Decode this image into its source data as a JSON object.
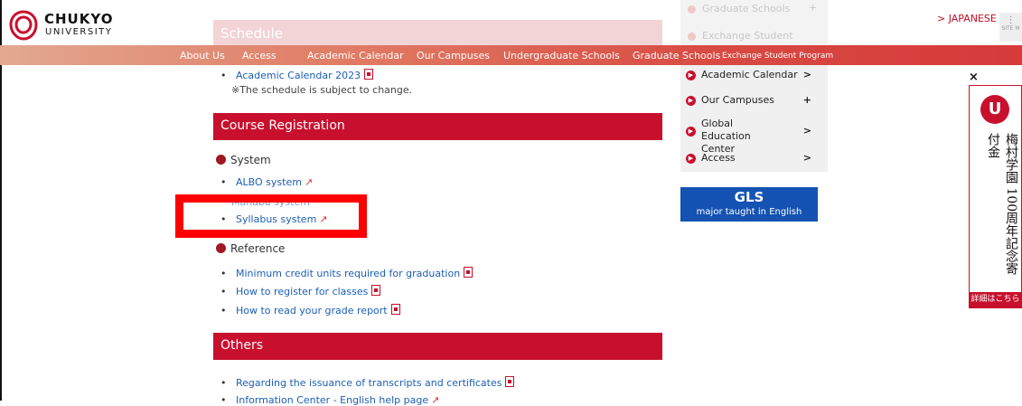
{
  "brand": {
    "name": "CHUKYO",
    "sub": "UNIVERSITY"
  },
  "header": {
    "ghost_section": "Schedule",
    "ghost_menu": [
      "Graduate Schools",
      "Exchange Student"
    ],
    "language": "> JAPANESE",
    "sitemap": "SITE M"
  },
  "nav": {
    "items": [
      "About Us",
      "Access",
      "Academic Calendar",
      "Our Campuses",
      "Undergraduate Schools",
      "Graduate Schools",
      "Exchange Student Program"
    ]
  },
  "schedule": {
    "calendar_link": "Academic Calendar 2023",
    "note": "※The schedule is subject to change."
  },
  "course_registration": {
    "title": "Course Registration",
    "system_heading": "System",
    "albo": "ALBO system",
    "hidden": "Manaba system",
    "syllabus": "Syllabus system",
    "reference_heading": "Reference",
    "ref_links": [
      "Minimum credit units required for graduation",
      "How to register for classes",
      "How to read your grade report"
    ]
  },
  "others": {
    "title": "Others",
    "links": [
      "Regarding the issuance of transcripts and certificates",
      "Information Center - English help page"
    ]
  },
  "side_menu": {
    "items": [
      {
        "label": "Academic Calendar",
        "indicator": ">"
      },
      {
        "label": "Our Campuses",
        "indicator": "+"
      },
      {
        "label": "Global Education Center",
        "indicator": ">"
      },
      {
        "label": "Access",
        "indicator": ">"
      }
    ]
  },
  "gls": {
    "title": "GLS",
    "subtitle": "major taught in English"
  },
  "ad": {
    "close": "×",
    "badge": "U",
    "text": "梅村学園 100周年記念寄付金",
    "footer": "詳細はこちら"
  },
  "colors": {
    "accent": "#c8102e",
    "link": "#1b5fb4",
    "gls": "#1452b3"
  }
}
